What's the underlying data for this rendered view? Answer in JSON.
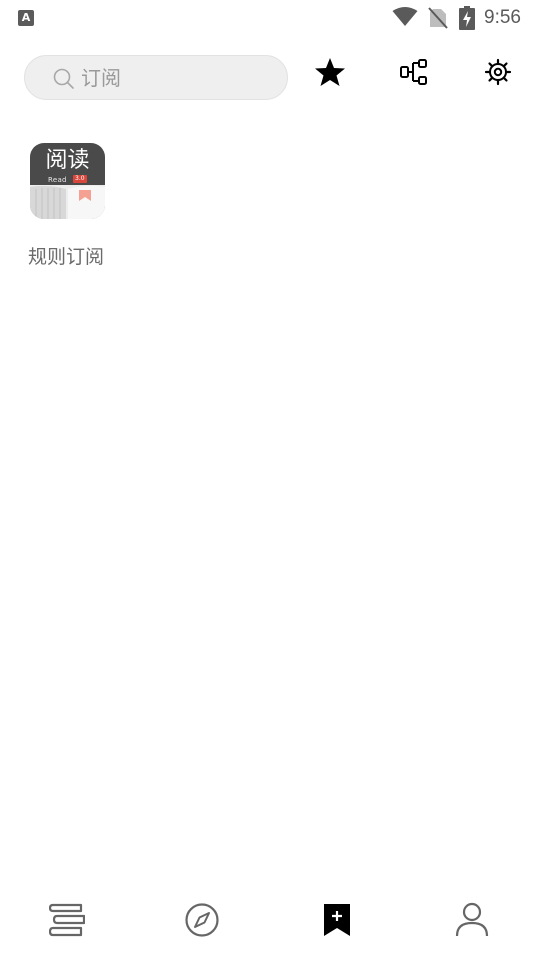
{
  "status_bar": {
    "notification_letter": "A",
    "time": "9:56"
  },
  "toolbar": {
    "search_placeholder": "订阅",
    "star_icon": "star-icon",
    "rule_icon": "rule-tree-icon",
    "settings_icon": "gear-icon"
  },
  "subscriptions": [
    {
      "label": "规则订阅",
      "icon_title": "阅读",
      "icon_subtitle": "Read",
      "icon_version": "3.0"
    }
  ],
  "bottom_nav": {
    "items": [
      "bookshelf-icon",
      "explore-compass-icon",
      "rss-bookmark-icon",
      "profile-icon"
    ],
    "active_index": 2
  },
  "colors": {
    "icon_active": "#000000",
    "icon_inactive": "#666666",
    "search_bg": "#efefef"
  }
}
